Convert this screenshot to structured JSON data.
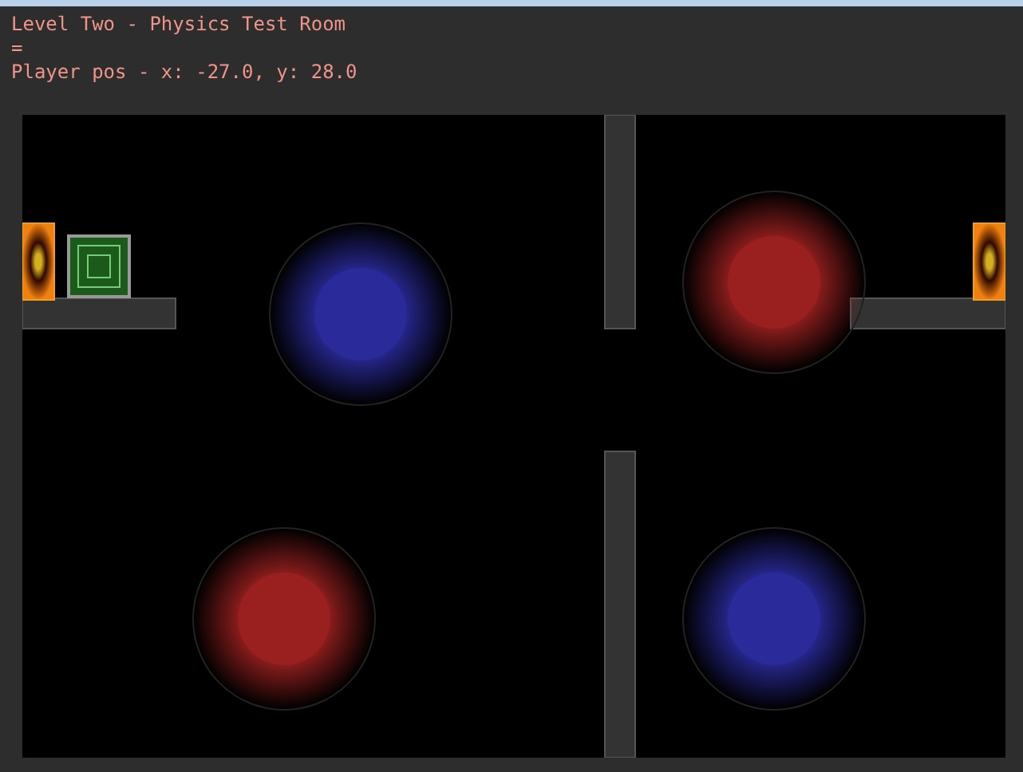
{
  "console_lines": [
    "Level Two - Physics Test Room",
    "=",
    "Player pos - x: -27.0, y: 28.0"
  ],
  "magnets": [
    {
      "color": "#2a2a9a"
    },
    {
      "color": "#9a2020"
    },
    {
      "color": "#9a2020"
    },
    {
      "color": "#2a2a9a"
    }
  ]
}
